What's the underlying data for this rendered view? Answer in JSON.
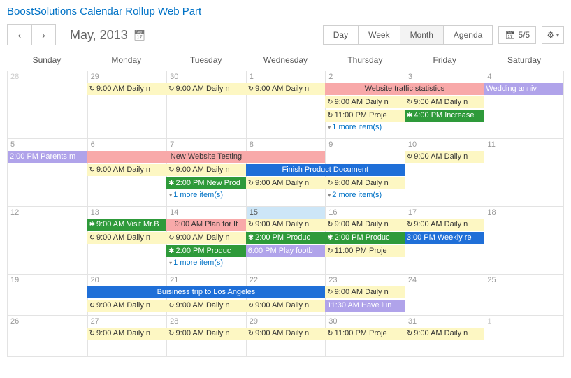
{
  "header": {
    "title": "BoostSolutions Calendar Rollup Web Part"
  },
  "toolbar": {
    "month_label": "May, 2013",
    "views": {
      "day": "Day",
      "week": "Week",
      "month": "Month",
      "agenda": "Agenda",
      "active": "month"
    },
    "count": "5/5"
  },
  "day_names": [
    "Sunday",
    "Monday",
    "Tuesday",
    "Wednesday",
    "Thursday",
    "Friday",
    "Saturday"
  ],
  "more_label_1": "1 more item(s)",
  "more_label_2": "2 more item(s)",
  "weeks": [
    {
      "dates": [
        {
          "n": "28",
          "other": true
        },
        {
          "n": "29"
        },
        {
          "n": "30"
        },
        {
          "n": "1"
        },
        {
          "n": "2"
        },
        {
          "n": "3"
        },
        {
          "n": "4"
        }
      ],
      "rows": [
        [
          {
            "col": 1,
            "span": 1,
            "cls": "yellow",
            "ic": "↻",
            "text": "9:00 AM Daily n"
          },
          {
            "col": 2,
            "span": 1,
            "cls": "yellow",
            "ic": "↻",
            "text": "9:00 AM Daily n"
          },
          {
            "col": 3,
            "span": 1,
            "cls": "yellow",
            "ic": "↻",
            "text": "9:00 AM Daily n"
          },
          {
            "col": 4,
            "span": 2,
            "cls": "pink",
            "text": "Website traffic statistics"
          },
          {
            "col": 6,
            "span": 1,
            "cls": "purple",
            "text": "Wedding anniv"
          }
        ],
        [
          {
            "col": 4,
            "span": 1,
            "cls": "yellow",
            "ic": "↻",
            "text": "9:00 AM Daily n"
          },
          {
            "col": 5,
            "span": 1,
            "cls": "yellow",
            "ic": "↻",
            "text": "9:00 AM Daily n"
          }
        ],
        [
          {
            "col": 4,
            "span": 1,
            "cls": "yellow",
            "ic": "↻",
            "text": "11:00 PM Proje"
          },
          {
            "col": 5,
            "span": 1,
            "cls": "green",
            "ic": "✱",
            "text": "4:00 PM Increase"
          }
        ],
        [
          {
            "col": 4,
            "more": "1"
          }
        ]
      ]
    },
    {
      "dates": [
        {
          "n": "5"
        },
        {
          "n": "6"
        },
        {
          "n": "7"
        },
        {
          "n": "8"
        },
        {
          "n": "9"
        },
        {
          "n": "10"
        },
        {
          "n": "11"
        }
      ],
      "rows": [
        [
          {
            "col": 0,
            "span": 1,
            "cls": "purple",
            "text": "2:00 PM Parents m"
          },
          {
            "col": 1,
            "span": 3,
            "cls": "pink",
            "text": "New Website Testing"
          },
          {
            "col": 5,
            "span": 1,
            "cls": "yellow",
            "ic": "↻",
            "text": "9:00 AM Daily n"
          }
        ],
        [
          {
            "col": 1,
            "span": 1,
            "cls": "yellow",
            "ic": "↻",
            "text": "9:00 AM Daily n"
          },
          {
            "col": 2,
            "span": 1,
            "cls": "yellow",
            "ic": "↻",
            "text": "9:00 AM Daily n"
          },
          {
            "col": 3,
            "span": 2,
            "cls": "blue",
            "text": "Finish Product Document"
          }
        ],
        [
          {
            "col": 2,
            "span": 1,
            "cls": "green",
            "ic": "✱",
            "text": "2:00 PM New Prod"
          },
          {
            "col": 3,
            "span": 1,
            "cls": "yellow",
            "ic": "↻",
            "text": "9:00 AM Daily n"
          },
          {
            "col": 4,
            "span": 1,
            "cls": "yellow",
            "ic": "↻",
            "text": "9:00 AM Daily n"
          }
        ],
        [
          {
            "col": 2,
            "more": "1"
          },
          {
            "col": 4,
            "more": "2"
          }
        ]
      ]
    },
    {
      "dates": [
        {
          "n": "12"
        },
        {
          "n": "13"
        },
        {
          "n": "14"
        },
        {
          "n": "15",
          "today": true
        },
        {
          "n": "16"
        },
        {
          "n": "17"
        },
        {
          "n": "18"
        }
      ],
      "rows": [
        [
          {
            "col": 1,
            "span": 1,
            "cls": "green",
            "ic": "✱",
            "text": "9:00 AM Visit Mr.B"
          },
          {
            "col": 2,
            "span": 1,
            "cls": "pink",
            "text": "9:00 AM Plan for It"
          },
          {
            "col": 3,
            "span": 1,
            "cls": "yellow",
            "ic": "↻",
            "text": "9:00 AM Daily n"
          },
          {
            "col": 4,
            "span": 1,
            "cls": "yellow",
            "ic": "↻",
            "text": "9:00 AM Daily n"
          },
          {
            "col": 5,
            "span": 1,
            "cls": "yellow",
            "ic": "↻",
            "text": "9:00 AM Daily n"
          }
        ],
        [
          {
            "col": 1,
            "span": 1,
            "cls": "yellow",
            "ic": "↻",
            "text": "9:00 AM Daily n"
          },
          {
            "col": 2,
            "span": 1,
            "cls": "yellow",
            "ic": "↻",
            "text": "9:00 AM Daily n"
          },
          {
            "col": 3,
            "span": 1,
            "cls": "green",
            "ic": "✱",
            "text": "2:00 PM Produc"
          },
          {
            "col": 4,
            "span": 1,
            "cls": "green",
            "ic": "✱",
            "text": "2:00 PM Produc"
          },
          {
            "col": 5,
            "span": 1,
            "cls": "bluebox",
            "text": "3:00 PM Weekly re"
          }
        ],
        [
          {
            "col": 2,
            "span": 1,
            "cls": "green",
            "ic": "✱",
            "text": "2:00 PM Produc"
          },
          {
            "col": 3,
            "span": 1,
            "cls": "purple",
            "text": "6:00 PM Play footb"
          },
          {
            "col": 4,
            "span": 1,
            "cls": "yellow",
            "ic": "↻",
            "text": "11:00 PM Proje"
          }
        ],
        [
          {
            "col": 2,
            "more": "1"
          }
        ]
      ]
    },
    {
      "dates": [
        {
          "n": "19"
        },
        {
          "n": "20"
        },
        {
          "n": "21"
        },
        {
          "n": "22"
        },
        {
          "n": "23"
        },
        {
          "n": "24"
        },
        {
          "n": "25"
        }
      ],
      "rows": [
        [
          {
            "col": 1,
            "span": 3,
            "cls": "blue",
            "text": "Buisiness trip to Los Angeles"
          },
          {
            "col": 4,
            "span": 1,
            "cls": "yellow",
            "ic": "↻",
            "text": "9:00 AM Daily n"
          }
        ],
        [
          {
            "col": 1,
            "span": 1,
            "cls": "yellow",
            "ic": "↻",
            "text": "9:00 AM Daily n"
          },
          {
            "col": 2,
            "span": 1,
            "cls": "yellow",
            "ic": "↻",
            "text": "9:00 AM Daily n"
          },
          {
            "col": 3,
            "span": 1,
            "cls": "yellow",
            "ic": "↻",
            "text": "9:00 AM Daily n"
          },
          {
            "col": 4,
            "span": 1,
            "cls": "purple",
            "text": "11:30 AM Have lun"
          }
        ]
      ]
    },
    {
      "dates": [
        {
          "n": "26"
        },
        {
          "n": "27"
        },
        {
          "n": "28"
        },
        {
          "n": "29"
        },
        {
          "n": "30"
        },
        {
          "n": "31"
        },
        {
          "n": "1",
          "other": true
        }
      ],
      "rows": [
        [
          {
            "col": 1,
            "span": 1,
            "cls": "yellow",
            "ic": "↻",
            "text": "9:00 AM Daily n"
          },
          {
            "col": 2,
            "span": 1,
            "cls": "yellow",
            "ic": "↻",
            "text": "9:00 AM Daily n"
          },
          {
            "col": 3,
            "span": 1,
            "cls": "yellow",
            "ic": "↻",
            "text": "9:00 AM Daily n"
          },
          {
            "col": 4,
            "span": 1,
            "cls": "yellow",
            "ic": "↻",
            "text": "11:00 PM Proje"
          },
          {
            "col": 5,
            "span": 1,
            "cls": "yellow",
            "ic": "↻",
            "text": "9:00 AM Daily n"
          }
        ]
      ]
    }
  ]
}
